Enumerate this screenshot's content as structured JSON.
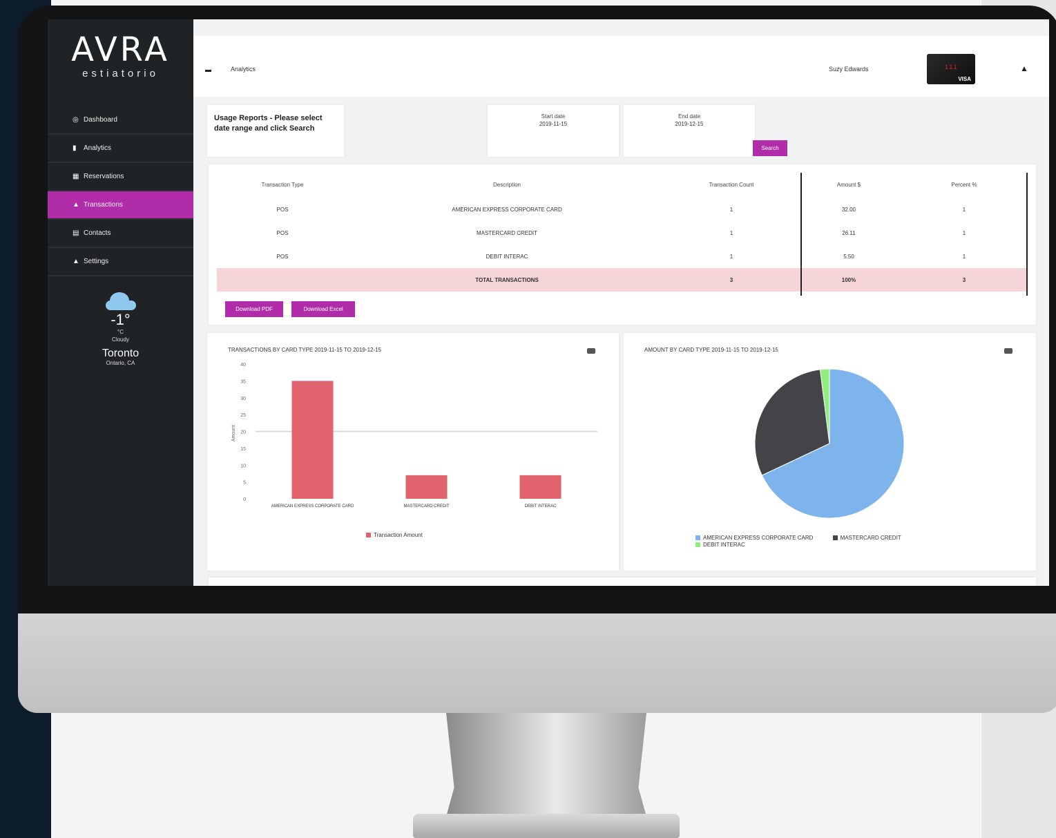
{
  "brand": {
    "logo_main": "AVRA",
    "logo_sub": "estiatorio"
  },
  "sidebar": {
    "items": [
      {
        "icon": "dashboard-icon",
        "glyph": "◎",
        "label": "Dashboard"
      },
      {
        "icon": "chart-icon",
        "glyph": "▮",
        "label": "Analytics"
      },
      {
        "icon": "calendar-icon",
        "glyph": "▦",
        "label": "Reservations"
      },
      {
        "icon": "user-icon",
        "glyph": "▲",
        "label": "Transactions"
      },
      {
        "icon": "document-icon",
        "glyph": "▤",
        "label": "Contacts"
      },
      {
        "icon": "settings-icon",
        "glyph": "▲",
        "label": "Settings"
      }
    ],
    "active_index": 3
  },
  "weather": {
    "temp": "-1°",
    "unit": "°C",
    "condition": "Cloudy",
    "city": "Toronto",
    "region": "Ontario, CA"
  },
  "topbar": {
    "title": "Analytics",
    "user": "Suzy Edwards"
  },
  "card": {
    "mid": "111",
    "brand": "VISA"
  },
  "date_range": {
    "prompt": "Usage Reports - Please select date range and click Search",
    "start_label": "Start date",
    "start_value": "2019-11-15",
    "end_label": "End date",
    "end_value": "2019-12-15",
    "search_label": "Search"
  },
  "table": {
    "headers": [
      "Transaction Type",
      "Description",
      "Transaction Count",
      "Amount $",
      "Percent %"
    ],
    "rows": [
      {
        "type": "POS",
        "description": "AMERICAN EXPRESS CORPORATE CARD",
        "count": "1",
        "amount": "32.00",
        "percent": "1"
      },
      {
        "type": "POS",
        "description": "MASTERCARD CREDIT",
        "count": "1",
        "amount": "26.11",
        "percent": "1"
      },
      {
        "type": "POS",
        "description": "DEBIT INTERAC",
        "count": "1",
        "amount": "5.50",
        "percent": "1"
      }
    ],
    "total": {
      "label": "TOTAL TRANSACTIONS",
      "count": "3",
      "amount": "100%",
      "percent": "3"
    },
    "export_pdf": "Download PDF",
    "export_excel": "Download Excel"
  },
  "bar_chart_meta": {
    "menu_icon": "hamburger-menu-icon",
    "color": "#e0636e"
  },
  "pie_chart_meta": {
    "menu_icon": "hamburger-menu-icon"
  },
  "chart_data": [
    {
      "type": "bar",
      "title": "TRANSACTIONS BY CARD TYPE 2019-11-15 TO 2019-12-15",
      "categories": [
        "AMERICAN EXPRESS CORPORATE CARD",
        "MASTERCARD CREDIT",
        "DEBIT INTERAC"
      ],
      "series": [
        {
          "name": "Transaction Amount",
          "values": [
            35,
            7,
            7
          ]
        }
      ],
      "ylabel": "Amount",
      "ylim": [
        0,
        40
      ],
      "yticks": [
        "40",
        "35",
        "30",
        "25",
        "20",
        "15",
        "10",
        "5",
        "0"
      ],
      "reference_line": 20,
      "colors": [
        "#e0636e"
      ]
    },
    {
      "type": "pie",
      "title": "AMOUNT BY CARD TYPE 2019-11-15 TO 2019-12-15",
      "labels": [
        "AMERICAN EXPRESS CORPORATE CARD",
        "MASTERCARD CREDIT",
        "DEBIT INTERAC"
      ],
      "values": [
        68,
        30,
        2
      ],
      "colors": [
        "#7cb4eb",
        "#434348",
        "#90ed7d"
      ],
      "legend": "bottom"
    }
  ]
}
